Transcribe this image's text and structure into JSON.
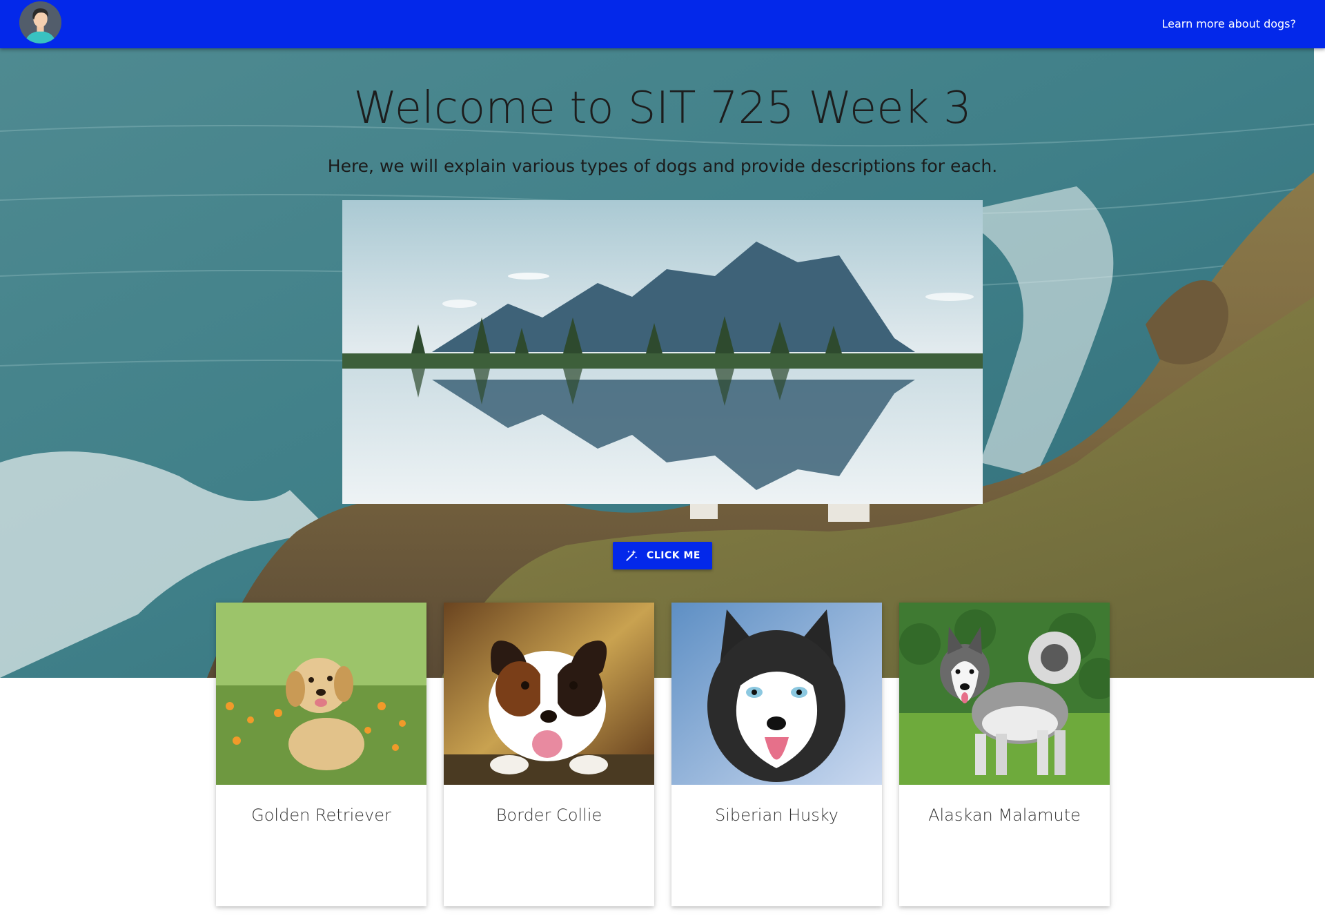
{
  "nav": {
    "link_label": "Learn more about dogs?",
    "avatar_icon": "user-avatar-icon"
  },
  "hero": {
    "title": "Welcome to SIT 725 Week 3",
    "subtitle": "Here, we will explain various types of dogs and provide descriptions for each.",
    "image_icon": "mountain-lake-image",
    "button_label": "CLICK ME",
    "button_icon": "magic-wand-icon"
  },
  "cards": [
    {
      "title": "Golden Retriever"
    },
    {
      "title": "Border Collie"
    },
    {
      "title": "Siberian Husky"
    },
    {
      "title": "Alaskan Malamute"
    }
  ],
  "colors": {
    "primary": "#0328ea",
    "text_dark": "#1d1d1d",
    "card_text": "#333333"
  }
}
